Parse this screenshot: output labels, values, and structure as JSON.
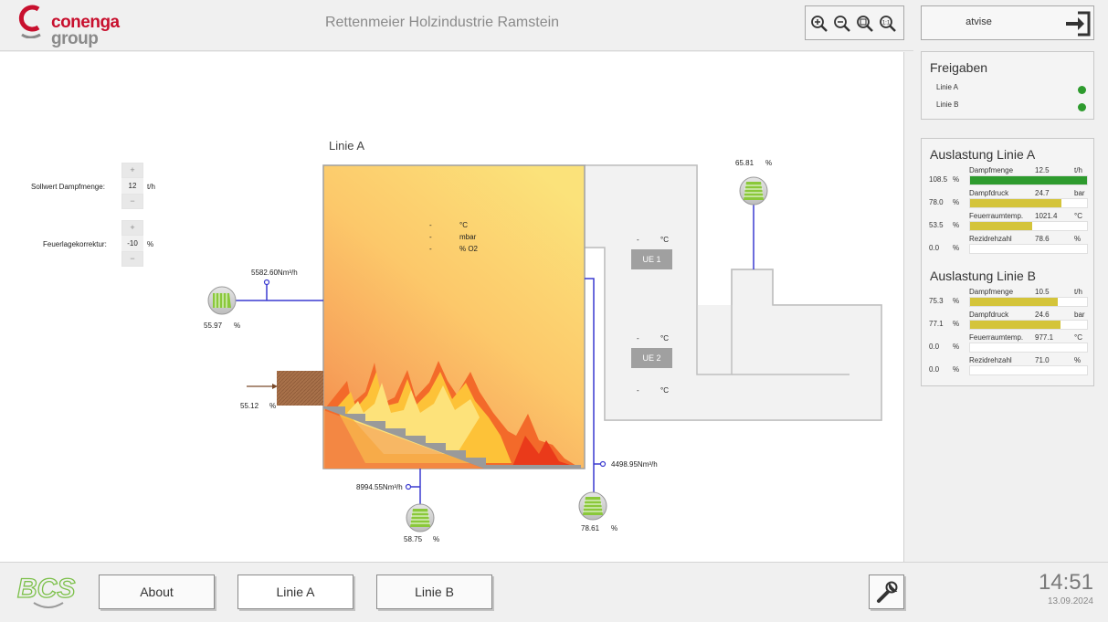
{
  "header": {
    "logo_brand_line1": "conenga",
    "logo_brand_line2": "group",
    "title": "Rettenmeier Holzindustrie Ramstein",
    "zoom_buttons": [
      "zoom-in",
      "zoom-out",
      "zoom-fit",
      "zoom-reset"
    ]
  },
  "user": {
    "name": "atvise",
    "logout_icon": "logout-icon"
  },
  "diagram": {
    "title": "Linie A",
    "setpoint_label": "Sollwert Dampfmenge:",
    "setpoint_value": "12",
    "setpoint_unit": "t/h",
    "correction_label": "Feuerlagekorrektur:",
    "correction_value": "-10",
    "correction_unit": "%",
    "stepper_plus": "+",
    "stepper_minus": "−",
    "furnace_readings": [
      {
        "value": "-",
        "unit": "°C"
      },
      {
        "value": "-",
        "unit": "mbar"
      },
      {
        "value": "-",
        "unit": "% O2"
      }
    ],
    "ue1": {
      "label": "UE 1",
      "value": "-",
      "unit": "°C"
    },
    "ue2": {
      "label": "UE 2",
      "value_top": "-",
      "unit_top": "°C",
      "value_bottom": "-",
      "unit_bottom": "°C"
    },
    "fan_left": {
      "value": "55.97",
      "unit": "%",
      "flow": "5582.60Nm³/h"
    },
    "feeder": {
      "value": "55.12",
      "unit": "%"
    },
    "fan_bottom": {
      "value": "58.75",
      "unit": "%",
      "flow": "8994.55Nm³/h"
    },
    "fan_right": {
      "value": "78.61",
      "unit": "%",
      "flow": "4498.95Nm³/h"
    },
    "fan_stack": {
      "value": "65.81",
      "unit": "%"
    }
  },
  "freigaben": {
    "title": "Freigaben",
    "items": [
      {
        "label": "Linie A",
        "status_color": "#2e9b2e"
      },
      {
        "label": "Linie B",
        "status_color": "#2e9b2e"
      }
    ]
  },
  "auslastung_a": {
    "title": "Auslastung Linie A",
    "rows": [
      {
        "pct": "108.5",
        "pct_unit": "%",
        "name": "Dampfmenge",
        "value": "12.5",
        "unit": "t/h",
        "fill": 1.0,
        "color": "#2e9b2e"
      },
      {
        "pct": "78.0",
        "pct_unit": "%",
        "name": "Dampfdruck",
        "value": "24.7",
        "unit": "bar",
        "fill": 0.78,
        "color": "#d4c43a"
      },
      {
        "pct": "53.5",
        "pct_unit": "%",
        "name": "Feuerraumtemp.",
        "value": "1021.4",
        "unit": "°C",
        "fill": 0.535,
        "color": "#d4c43a"
      },
      {
        "pct": "0.0",
        "pct_unit": "%",
        "name": "Rezidrehzahl",
        "value": "78.6",
        "unit": "%",
        "fill": 0.0,
        "color": "#d4c43a"
      }
    ]
  },
  "auslastung_b": {
    "title": "Auslastung Linie B",
    "rows": [
      {
        "pct": "75.3",
        "pct_unit": "%",
        "name": "Dampfmenge",
        "value": "10.5",
        "unit": "t/h",
        "fill": 0.753,
        "color": "#d4c43a"
      },
      {
        "pct": "77.1",
        "pct_unit": "%",
        "name": "Dampfdruck",
        "value": "24.6",
        "unit": "bar",
        "fill": 0.771,
        "color": "#d4c43a"
      },
      {
        "pct": "0.0",
        "pct_unit": "%",
        "name": "Feuerraumtemp.",
        "value": "977.1",
        "unit": "°C",
        "fill": 0.0,
        "color": "#d4c43a"
      },
      {
        "pct": "0.0",
        "pct_unit": "%",
        "name": "Rezidrehzahl",
        "value": "71.0",
        "unit": "%",
        "fill": 0.0,
        "color": "#d4c43a"
      }
    ]
  },
  "footer": {
    "logo": "BCS",
    "nav": [
      "About",
      "Linie A",
      "Linie B"
    ],
    "tool_icon": "wrench-icon",
    "time": "14:51",
    "date": "13.09.2024"
  },
  "colors": {
    "brand_red": "#c8102e",
    "ok_green": "#2e9b2e",
    "bar_yellow": "#d4c43a",
    "pipe_blue": "#3a3ad0"
  }
}
